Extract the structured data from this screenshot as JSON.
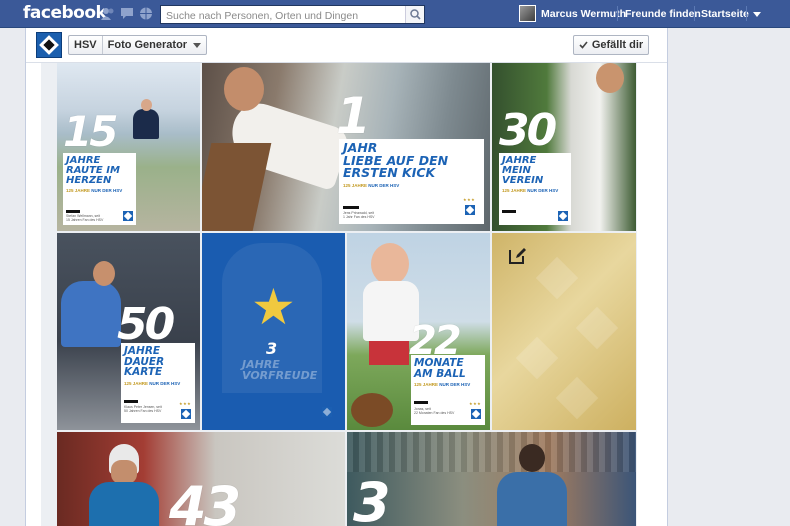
{
  "topbar": {
    "logo": "facebook",
    "search_placeholder": "Suche nach Personen, Orten und Dingen",
    "user_name": "Marcus Wermuth",
    "find_friends": "Freunde finden",
    "home": "Startseite",
    "icons": [
      "friend-requests-icon",
      "messages-icon",
      "notifications-icon",
      "search-icon",
      "account-menu-icon"
    ]
  },
  "app": {
    "breadcrumb_page": "HSV",
    "breadcrumb_app": "Foto Generator",
    "like_label": "Gefällt dir",
    "brand_colors": {
      "hsv_blue": "#1c63b5",
      "gold": "#c39a22",
      "fb_blue": "#3b5998"
    }
  },
  "tiles": [
    {
      "number": "15",
      "headline": "JAHRE\nRAUTE IM\nHERZEN",
      "tagline_gold": "125 JAHRE",
      "tagline_blue": "NUR DER HSV",
      "caption": "Stefan Wellmann, seit\n15 Jahren Fan des HSV"
    },
    {
      "number": "1",
      "headline": "JAHR\nLIEBE AUF DEN\nERSTEN KICK",
      "tagline_gold": "125 JAHRE",
      "tagline_blue": "NUR DER HSV",
      "caption": "Jens Prinzwald, seit\n1 Jahr Fan des HSV"
    },
    {
      "number": "30",
      "headline": "JAHRE\nMEIN\nVEREIN",
      "tagline_gold": "125 JAHRE",
      "tagline_blue": "NUR DER HSV",
      "caption": ""
    },
    {
      "number": "50",
      "headline": "JAHRE\nDAUER\nKARTE",
      "tagline_gold": "125 JAHRE",
      "tagline_blue": "NUR DER HSV",
      "caption": "Klaus Peter Jensen, seit\n50 Jahren Fan des HSV"
    },
    {
      "number": "3",
      "headline": "JAHRE\nVORFREUDE",
      "tagline_gold": "",
      "tagline_blue": "",
      "caption": ""
    },
    {
      "number": "22",
      "headline": "MONATE\nAM BALL",
      "tagline_gold": "125 JAHRE",
      "tagline_blue": "NUR DER HSV",
      "caption": "Jonas, seit\n22 Monaten Fan des HSV"
    },
    {
      "number": "",
      "headline": "",
      "tagline_gold": "",
      "tagline_blue": "",
      "caption": "",
      "icon": "edit-icon"
    },
    {
      "number": "43",
      "headline": "",
      "tagline_gold": "",
      "tagline_blue": "",
      "caption": ""
    },
    {
      "number": "3",
      "headline": "",
      "tagline_gold": "",
      "tagline_blue": "",
      "caption": ""
    }
  ]
}
